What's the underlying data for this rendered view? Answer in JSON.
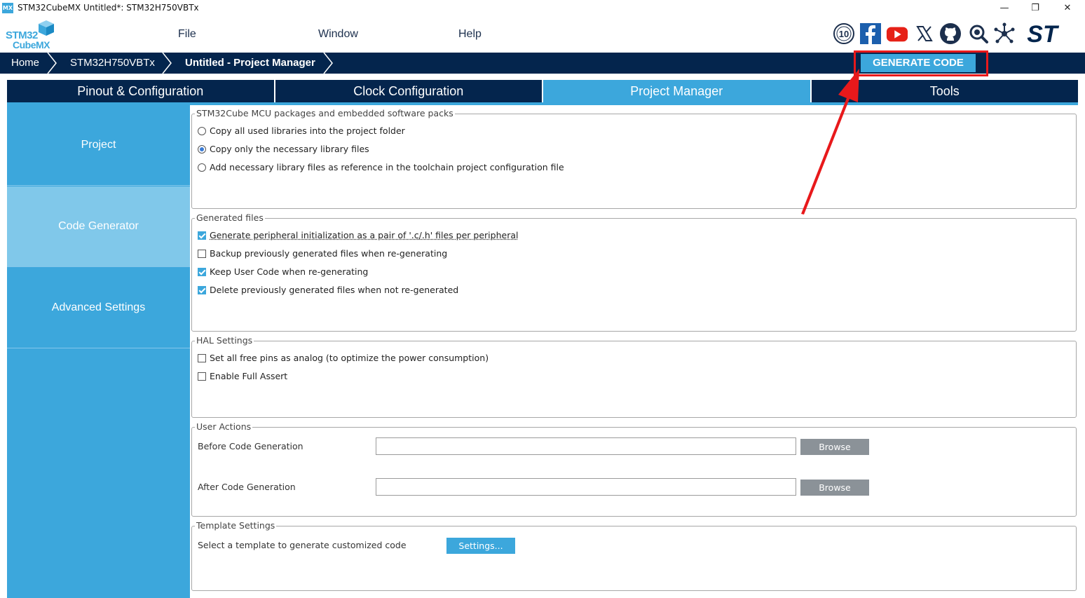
{
  "window": {
    "icon_text": "MX",
    "title": "STM32CubeMX Untitled*: STM32H750VBTx",
    "minimize": "—",
    "restore": "❐",
    "close": "✕"
  },
  "logo": {
    "line1": "STM32",
    "line2": "CubeMX"
  },
  "menu": {
    "file": "File",
    "window": "Window",
    "help": "Help"
  },
  "social_icons": [
    "anniversary-10-icon",
    "facebook-icon",
    "youtube-icon",
    "x-icon",
    "github-icon",
    "community-icon",
    "network-icon",
    "st-logo-icon"
  ],
  "social_text": {
    "anniversary": "10",
    "st": "ST"
  },
  "breadcrumb": {
    "home": "Home",
    "device": "STM32H750VBTx",
    "page": "Untitled - Project Manager"
  },
  "generate_button": "GENERATE CODE",
  "tabs": [
    "Pinout & Configuration",
    "Clock Configuration",
    "Project Manager",
    "Tools"
  ],
  "active_tab": "Project Manager",
  "sidenav": [
    "Project",
    "Code Generator",
    "Advanced Settings"
  ],
  "active_side": "Code Generator",
  "packs": {
    "title": "STM32Cube MCU packages and embedded software packs",
    "options": [
      {
        "label": "Copy all used libraries into the project folder",
        "selected": false
      },
      {
        "label": "Copy only the necessary library files",
        "selected": true
      },
      {
        "label": "Add necessary library files as reference in the toolchain project configuration file",
        "selected": false
      }
    ]
  },
  "generated": {
    "title": "Generated files",
    "options": [
      {
        "label": "Generate peripheral initialization as a pair of '.c/.h' files per peripheral",
        "checked": true
      },
      {
        "label": "Backup previously generated files when re-generating",
        "checked": false
      },
      {
        "label": "Keep User Code when re-generating",
        "checked": true
      },
      {
        "label": "Delete previously generated files when not re-generated",
        "checked": true
      }
    ]
  },
  "hal": {
    "title": "HAL Settings",
    "options": [
      {
        "label": "Set all free pins as analog (to optimize the power consumption)",
        "checked": false
      },
      {
        "label": "Enable Full Assert",
        "checked": false
      }
    ]
  },
  "user_actions": {
    "title": "User Actions",
    "before_label": "Before Code Generation",
    "before_value": "",
    "after_label": "After Code Generation",
    "after_value": "",
    "browse_label": "Browse"
  },
  "template": {
    "title": "Template Settings",
    "label": "Select a template to generate customized code",
    "button": "Settings..."
  },
  "colors": {
    "navy": "#04254d",
    "blue": "#3ca7dc",
    "light_blue": "#80c8ea",
    "highlight_red": "#e8191b"
  }
}
